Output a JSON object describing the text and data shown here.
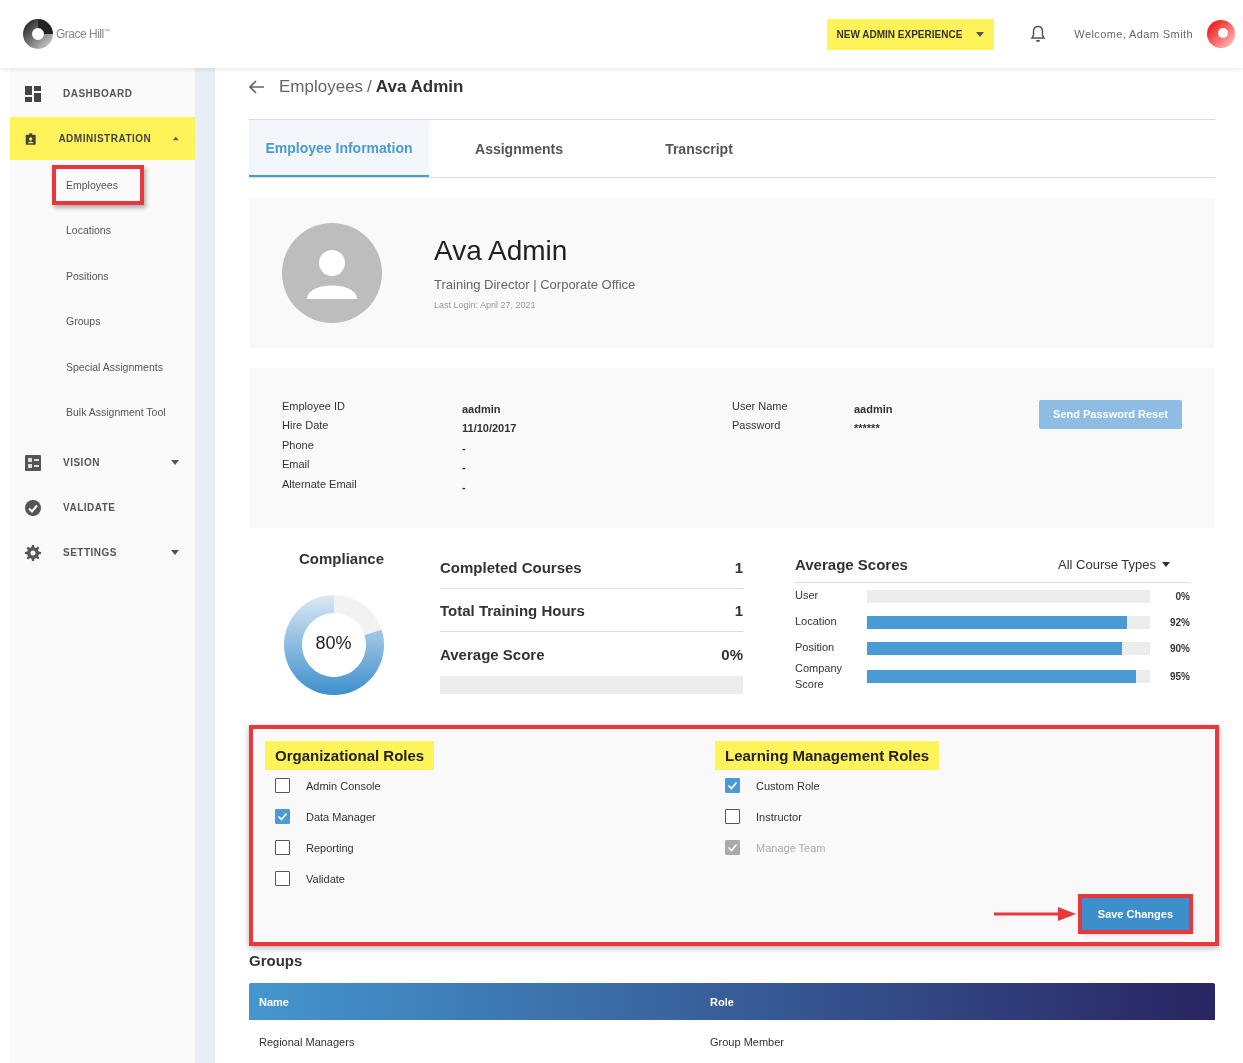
{
  "header": {
    "logo": "Grace Hill$^{™}$",
    "experience_button": {
      "label": "NEW ADMIN EXPERIENCE",
      "highlighted": true
    },
    "welcome": "Welcome, Adam Smith"
  },
  "sidebar": {
    "items": [
      {
        "label": "DASHBOARD",
        "highlighted": false
      },
      {
        "label": "ADMINISTRATION",
        "highlighted": true,
        "expanded": true,
        "children": [
          {
            "label": "Employees",
            "highlighted": true
          },
          {
            "label": "Locations",
            "highlighted": false
          },
          {
            "label": "Positions",
            "highlighted": false
          },
          {
            "label": "Groups",
            "highlighted": false
          },
          {
            "label": "Special Assignments",
            "highlighted": false
          },
          {
            "label": "Bulk Assignment Tool",
            "highlighted": false
          }
        ]
      },
      {
        "label": "VISION",
        "highlighted": false,
        "expanded": false
      },
      {
        "label": "VALIDATE",
        "highlighted": false
      },
      {
        "label": "SETTINGS",
        "highlighted": false,
        "expanded": false
      }
    ]
  },
  "breadcrumb": {
    "parent": "Employees",
    "separator": "/",
    "current": "Ava Admin"
  },
  "tabs": [
    {
      "label": "Employee Information",
      "selected": true
    },
    {
      "label": "Assignments",
      "selected": false
    },
    {
      "label": "Transcript",
      "selected": false
    }
  ],
  "profile": {
    "name": "Ava Admin",
    "subtitle": "Training Director | Corporate Office",
    "last_login": "Last Login: April 27, 2021"
  },
  "details": {
    "left": [
      {
        "label": "Employee ID",
        "value": "aadmin"
      },
      {
        "label": "Hire Date",
        "value": "11/10/2017"
      },
      {
        "label": "Phone",
        "value": "-"
      },
      {
        "label": "Email",
        "value": "-"
      },
      {
        "label": "Alternate Email",
        "value": "-"
      }
    ],
    "right": [
      {
        "label": "User Name",
        "value": "aadmin"
      },
      {
        "label": "Password",
        "value": "******"
      }
    ],
    "reset_button": {
      "label": "Send Password Reset",
      "disabled": true
    }
  },
  "compliance": {
    "title": "Compliance",
    "reading": "80%",
    "chart_data": {
      "type": "donut",
      "values": [
        80,
        20
      ]
    }
  },
  "stats": {
    "rows": [
      {
        "label": "Completed Courses",
        "value": "1"
      },
      {
        "label": "Total Training Hours",
        "value": "1"
      },
      {
        "label": "Average Score",
        "value": "0%"
      }
    ],
    "level": 0
  },
  "average_scores": {
    "title": "Average Scores",
    "filter": "All Course Types",
    "rows": [
      {
        "label": "User",
        "level": 0,
        "reading": "0%"
      },
      {
        "label": "Location",
        "level": 0.92,
        "reading": "92%"
      },
      {
        "label": "Position",
        "level": 0.9,
        "reading": "90%"
      },
      {
        "label": "Company Score",
        "level": 0.95,
        "reading": "95%"
      }
    ]
  },
  "roles": {
    "highlighted": true,
    "columns": [
      {
        "title": "Organizational Roles",
        "items": [
          {
            "label": "Admin Console",
            "checked": false,
            "disabled": false
          },
          {
            "label": "Data Manager",
            "checked": true,
            "disabled": false
          },
          {
            "label": "Reporting",
            "checked": false,
            "disabled": false
          },
          {
            "label": "Validate",
            "checked": false,
            "disabled": false
          }
        ]
      },
      {
        "title": "Learning Management Roles",
        "items": [
          {
            "label": "Custom Role",
            "checked": true,
            "disabled": false
          },
          {
            "label": "Instructor",
            "checked": false,
            "disabled": false
          },
          {
            "label": "Manage Team",
            "checked": true,
            "disabled": true
          }
        ]
      }
    ],
    "save_button": {
      "label": "Save Changes",
      "highlighted": true,
      "pointed": true
    }
  },
  "groups": {
    "title": "Groups",
    "columns": [
      "Name",
      "Role"
    ],
    "rows": [
      [
        "Regional Managers",
        "Group Member"
      ]
    ]
  }
}
